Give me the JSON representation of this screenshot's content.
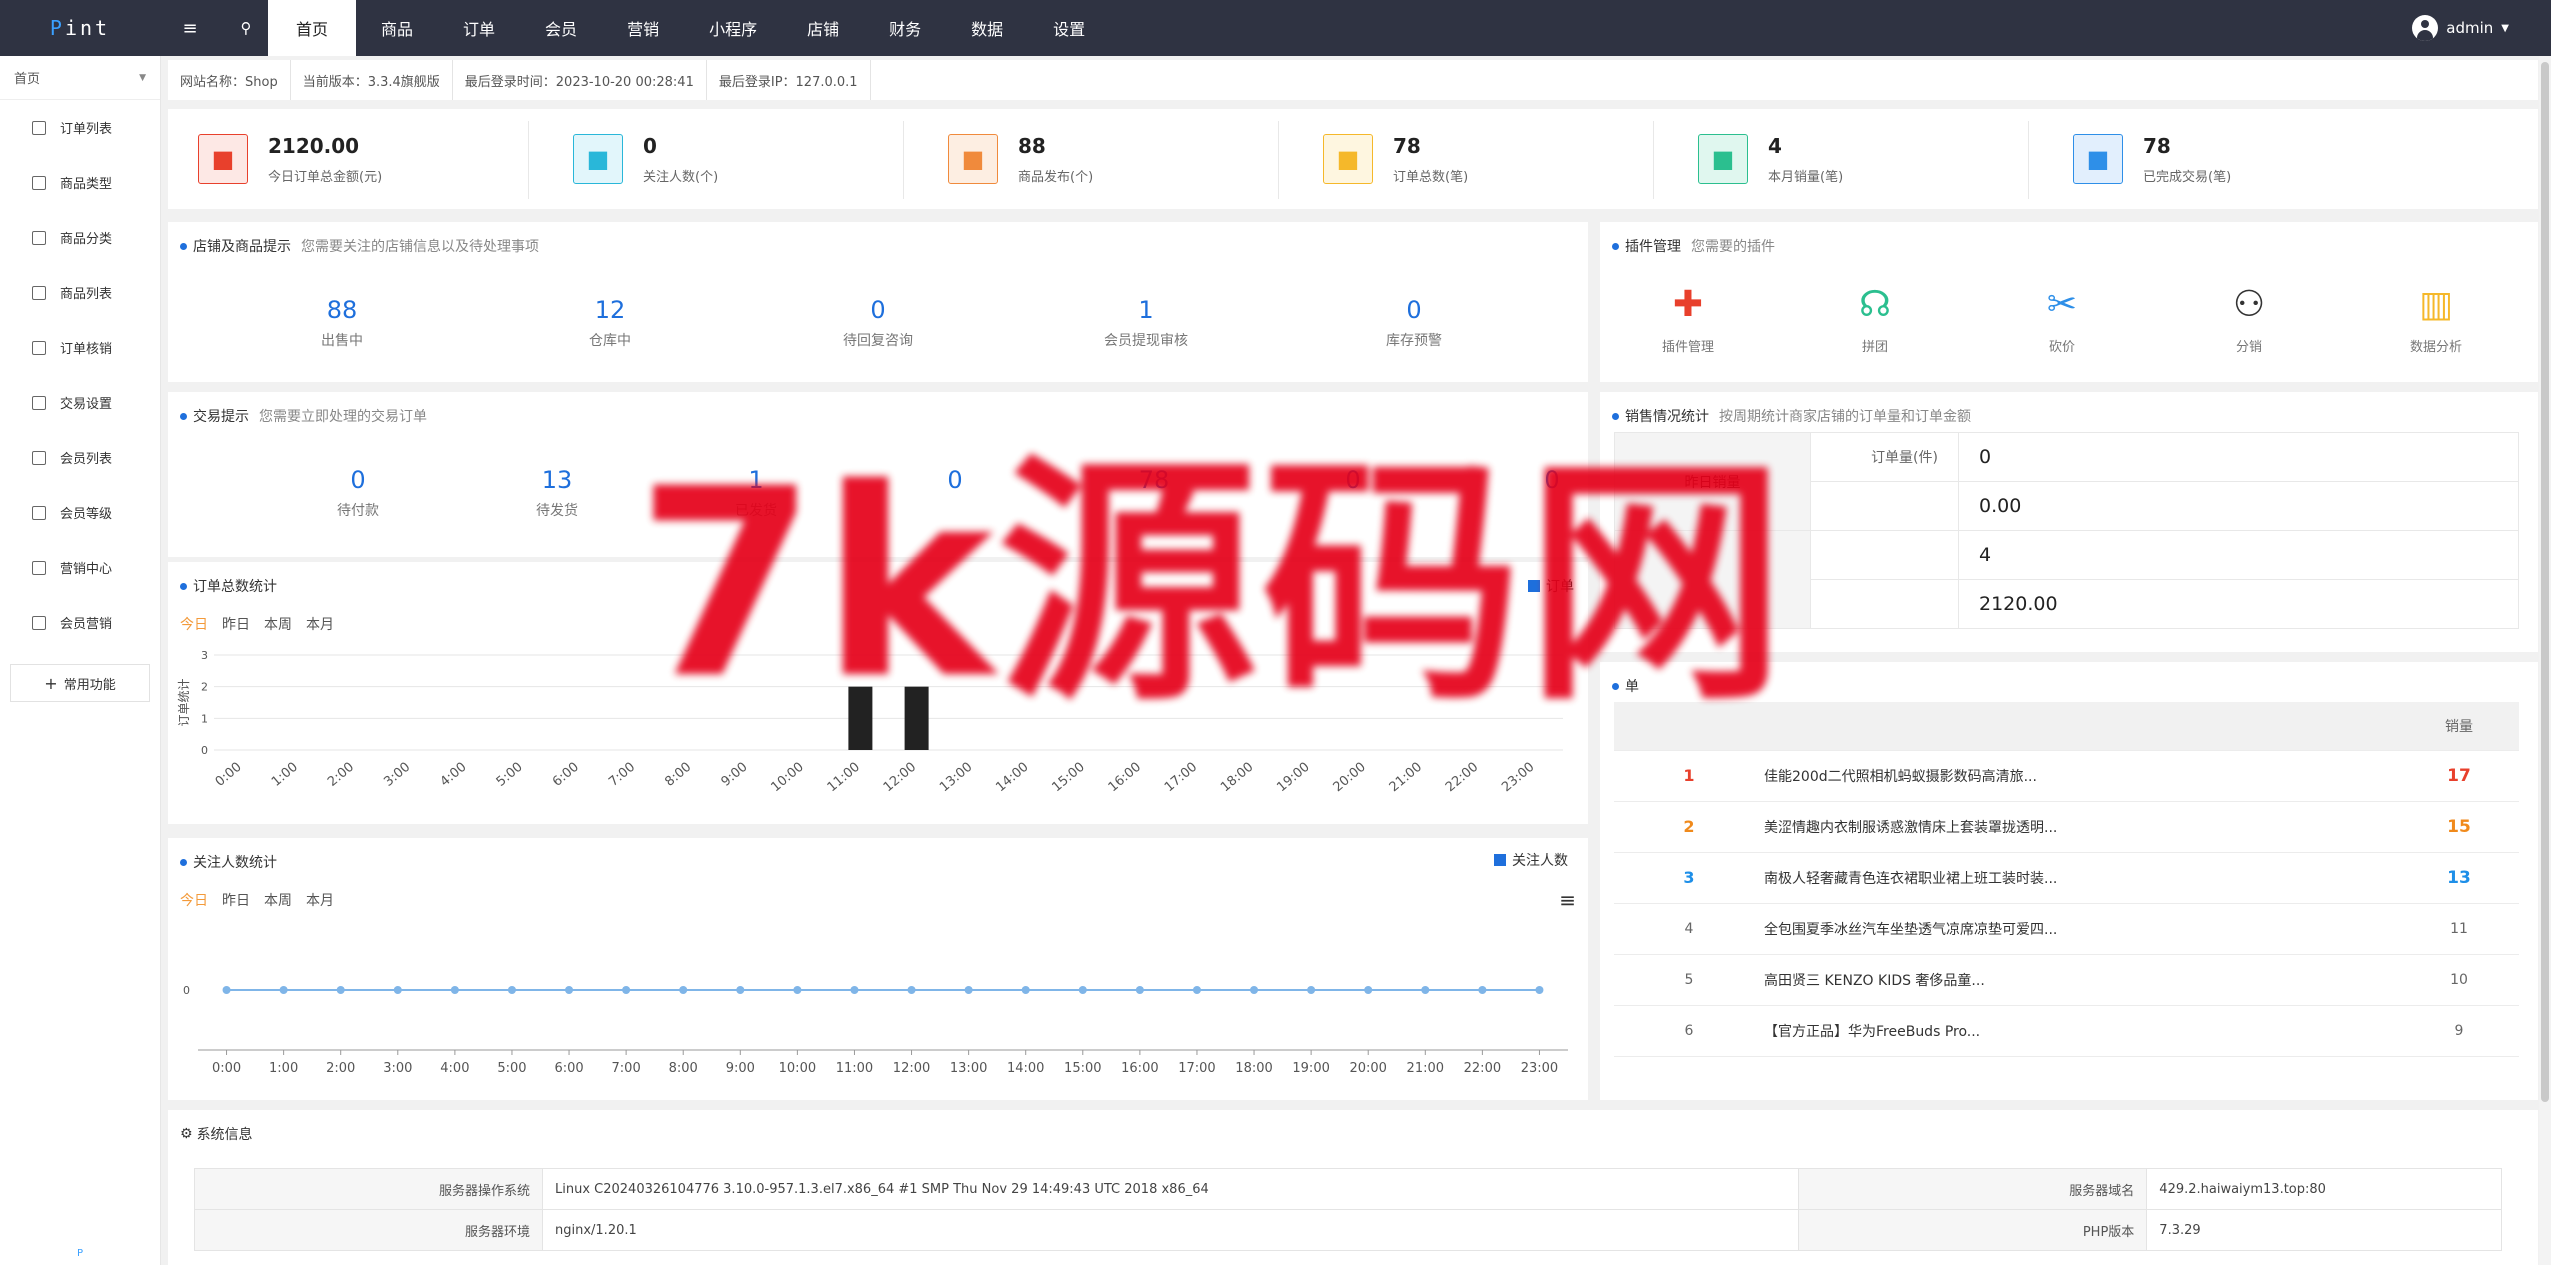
{
  "topbar": {
    "logo_p": "P",
    "logo_rest": "int",
    "nav": [
      "首页",
      "商品",
      "订单",
      "会员",
      "营销",
      "小程序",
      "店铺",
      "财务",
      "数据",
      "设置"
    ],
    "user": "admin"
  },
  "sidebar": {
    "home": "首页",
    "items": [
      "订单列表",
      "商品类型",
      "商品分类",
      "商品列表",
      "订单核销",
      "交易设置",
      "会员列表",
      "会员等级",
      "营销中心",
      "会员营销"
    ],
    "common": "常用功能",
    "footer": "P"
  },
  "infobar": {
    "site_name": "网站名称：Shop",
    "version": "当前版本：3.3.4旗舰版",
    "last_login_time": "最后登录时间：2023-10-20 00:28:41",
    "last_login_ip": "最后登录IP：127.0.0.1"
  },
  "stats": [
    {
      "value": "2120.00",
      "label": "今日订单总金额(元)",
      "icon": "yen-icon",
      "color": "#e8402c",
      "bg": "#fde8e5"
    },
    {
      "value": "0",
      "label": "关注人数(个)",
      "icon": "thumbs-up-icon",
      "color": "#29b7d9",
      "bg": "#e2f6fb"
    },
    {
      "value": "88",
      "label": "商品发布(个)",
      "icon": "send-icon",
      "color": "#f08a3c",
      "bg": "#fdeee2"
    },
    {
      "value": "78",
      "label": "订单总数(笔)",
      "icon": "chart-up-icon",
      "color": "#f5b82a",
      "bg": "#fef6e0"
    },
    {
      "value": "4",
      "label": "本月销量(笔)",
      "icon": "clipboard-icon",
      "color": "#2bbf8f",
      "bg": "#e0f7ef"
    },
    {
      "value": "78",
      "label": "已完成交易(笔)",
      "icon": "calendar-icon",
      "color": "#2e8fe8",
      "bg": "#e2effd"
    }
  ],
  "shop_tips": {
    "title": "店铺及商品提示",
    "sub": "您需要关注的店铺信息以及待处理事项",
    "items": [
      {
        "value": "88",
        "label": "出售中"
      },
      {
        "value": "12",
        "label": "仓库中"
      },
      {
        "value": "0",
        "label": "待回复咨询"
      },
      {
        "value": "1",
        "label": "会员提现审核"
      },
      {
        "value": "0",
        "label": "库存预警"
      }
    ]
  },
  "plugins": {
    "title": "插件管理",
    "sub": "您需要的插件",
    "items": [
      {
        "label": "插件管理",
        "icon": "puzzle-icon",
        "color": "#e8402c",
        "glyph": "✚"
      },
      {
        "label": "拼团",
        "icon": "group-icon",
        "color": "#2bbf8f",
        "glyph": "☊"
      },
      {
        "label": "砍价",
        "icon": "tag-icon",
        "color": "#2e8fe8",
        "glyph": "✂"
      },
      {
        "label": "分销",
        "icon": "network-icon",
        "color": "#333333",
        "glyph": "⚇"
      },
      {
        "label": "数据分析",
        "icon": "bar-chart-icon",
        "color": "#f5b82a",
        "glyph": "▥"
      }
    ]
  },
  "trade_tips": {
    "title": "交易提示",
    "sub": "您需要立即处理的交易订单",
    "items": [
      {
        "value": "0",
        "label": "待付款"
      },
      {
        "value": "13",
        "label": "待发货"
      },
      {
        "value": "1",
        "label": "已发货"
      },
      {
        "value": "0",
        "label": ""
      },
      {
        "value": "78",
        "label": ""
      },
      {
        "value": "0",
        "label": ""
      },
      {
        "value": "0",
        "label": ""
      }
    ]
  },
  "sales_stats": {
    "title": "销售情况统计",
    "sub": "按周期统计商家店铺的订单量和订单金额",
    "rows": [
      {
        "group": "昨日销量",
        "k1": "订单量(件)",
        "v1": "0",
        "k2": "",
        "v2": "0.00"
      },
      {
        "group": "",
        "k1": "",
        "v1": "4",
        "k2": "",
        "v2": "2120.00"
      }
    ]
  },
  "ranking": {
    "title": "单",
    "sub": "",
    "col_sales": "销量",
    "items": [
      {
        "rank": "1",
        "name": "佳能200d二代照相机蚂蚁摄影数码高清旅...",
        "sales": "17",
        "color": "#e8402c"
      },
      {
        "rank": "2",
        "name": "美涩情趣内衣制服诱惑激情床上套装罩拢透明...",
        "sales": "15",
        "color": "#f08a1c"
      },
      {
        "rank": "3",
        "name": "南极人轻奢藏青色连衣裙职业裙上班工装时装...",
        "sales": "13",
        "color": "#1e8fe8"
      },
      {
        "rank": "4",
        "name": "全包围夏季冰丝汽车坐垫透气凉席凉垫可爱四...",
        "sales": "11",
        "color": "#666666"
      },
      {
        "rank": "5",
        "name": "高田贤三 KENZO KIDS 奢侈品童...",
        "sales": "10",
        "color": "#666666"
      },
      {
        "rank": "6",
        "name": "【官方正品】华为FreeBuds Pro...",
        "sales": "9",
        "color": "#666666"
      }
    ]
  },
  "order_chart": {
    "title": "订单总数统计",
    "tabs": [
      "今日",
      "昨日",
      "本周",
      "本月"
    ],
    "legend": "订单",
    "chart_data": {
      "type": "bar",
      "categories": [
        "0:00",
        "1:00",
        "2:00",
        "3:00",
        "4:00",
        "5:00",
        "6:00",
        "7:00",
        "8:00",
        "9:00",
        "10:00",
        "11:00",
        "12:00",
        "13:00",
        "14:00",
        "15:00",
        "16:00",
        "17:00",
        "18:00",
        "19:00",
        "20:00",
        "21:00",
        "22:00",
        "23:00"
      ],
      "values": [
        0,
        0,
        0,
        0,
        0,
        0,
        0,
        0,
        0,
        0,
        0,
        2,
        2,
        0,
        0,
        0,
        0,
        0,
        0,
        0,
        0,
        0,
        0,
        0
      ],
      "ylabel": "订单统计",
      "yticks": [
        "0",
        "1",
        "2",
        "3"
      ],
      "ylim": [
        0,
        3
      ]
    }
  },
  "follow_chart": {
    "title": "关注人数统计",
    "tabs": [
      "今日",
      "昨日",
      "本周",
      "本月"
    ],
    "legend": "关注人数",
    "chart_data": {
      "type": "line",
      "categories": [
        "0:00",
        "1:00",
        "2:00",
        "3:00",
        "4:00",
        "5:00",
        "6:00",
        "7:00",
        "8:00",
        "9:00",
        "10:00",
        "11:00",
        "12:00",
        "13:00",
        "14:00",
        "15:00",
        "16:00",
        "17:00",
        "18:00",
        "19:00",
        "20:00",
        "21:00",
        "22:00",
        "23:00"
      ],
      "values": [
        0,
        0,
        0,
        0,
        0,
        0,
        0,
        0,
        0,
        0,
        0,
        0,
        0,
        0,
        0,
        0,
        0,
        0,
        0,
        0,
        0,
        0,
        0,
        0
      ],
      "yticks": [
        "0"
      ]
    }
  },
  "system": {
    "title": "系统信息",
    "rows": [
      {
        "k1": "服务器操作系统",
        "v1": "Linux C20240326104776 3.10.0-957.1.3.el7.x86_64 #1 SMP Thu Nov 29 14:49:43 UTC 2018 x86_64",
        "k2": "服务器域名",
        "v2": "429.2.haiwaiym13.top:80"
      },
      {
        "k1": "服务器环境",
        "v1": "nginx/1.20.1",
        "k2": "PHP版本",
        "v2": "7.3.29"
      }
    ]
  },
  "watermark": "7k源码网"
}
